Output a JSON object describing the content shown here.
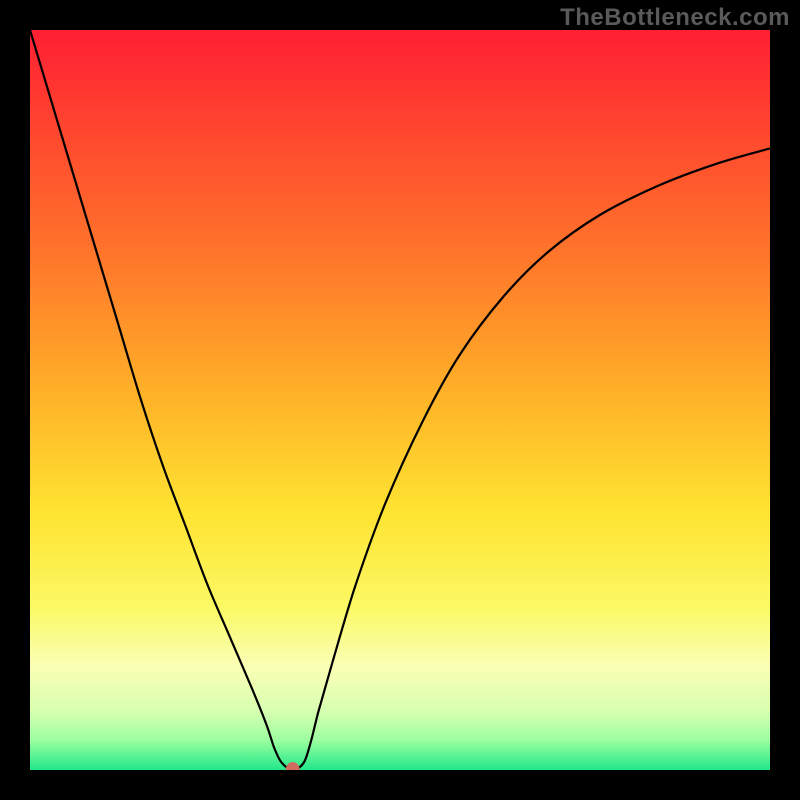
{
  "watermark": "TheBottleneck.com",
  "chart_data": {
    "type": "line",
    "title": "",
    "xlabel": "",
    "ylabel": "",
    "xlim": [
      0,
      100
    ],
    "ylim": [
      0,
      100
    ],
    "grid": false,
    "legend": false,
    "background_gradient": {
      "stops": [
        {
          "offset": 0.0,
          "color": "#ff1f33"
        },
        {
          "offset": 0.15,
          "color": "#ff4a2e"
        },
        {
          "offset": 0.32,
          "color": "#ff7a2a"
        },
        {
          "offset": 0.5,
          "color": "#ffb428"
        },
        {
          "offset": 0.65,
          "color": "#ffe331"
        },
        {
          "offset": 0.78,
          "color": "#fbf964"
        },
        {
          "offset": 0.86,
          "color": "#faffb5"
        },
        {
          "offset": 0.92,
          "color": "#d8ffb0"
        },
        {
          "offset": 0.96,
          "color": "#9bff9f"
        },
        {
          "offset": 1.0,
          "color": "#21e88a"
        }
      ]
    },
    "series": [
      {
        "name": "curve",
        "color": "#000000",
        "width": 2.2,
        "x": [
          0,
          3,
          6,
          9,
          12,
          15,
          18,
          21,
          24,
          27,
          30,
          32,
          33,
          34,
          35.5,
          37,
          38,
          39,
          41,
          44,
          48,
          53,
          58,
          64,
          70,
          77,
          85,
          93,
          100
        ],
        "y": [
          100,
          90,
          80,
          70,
          60,
          50,
          41,
          33,
          25,
          18,
          11,
          6,
          3,
          1,
          0,
          1,
          4,
          8,
          15,
          25,
          36,
          47,
          56,
          64,
          70,
          75,
          79,
          82,
          84
        ]
      }
    ],
    "marker": {
      "x": 35.5,
      "y": 0,
      "rx": 7,
      "ry": 8,
      "color": "#d16a5f"
    }
  }
}
